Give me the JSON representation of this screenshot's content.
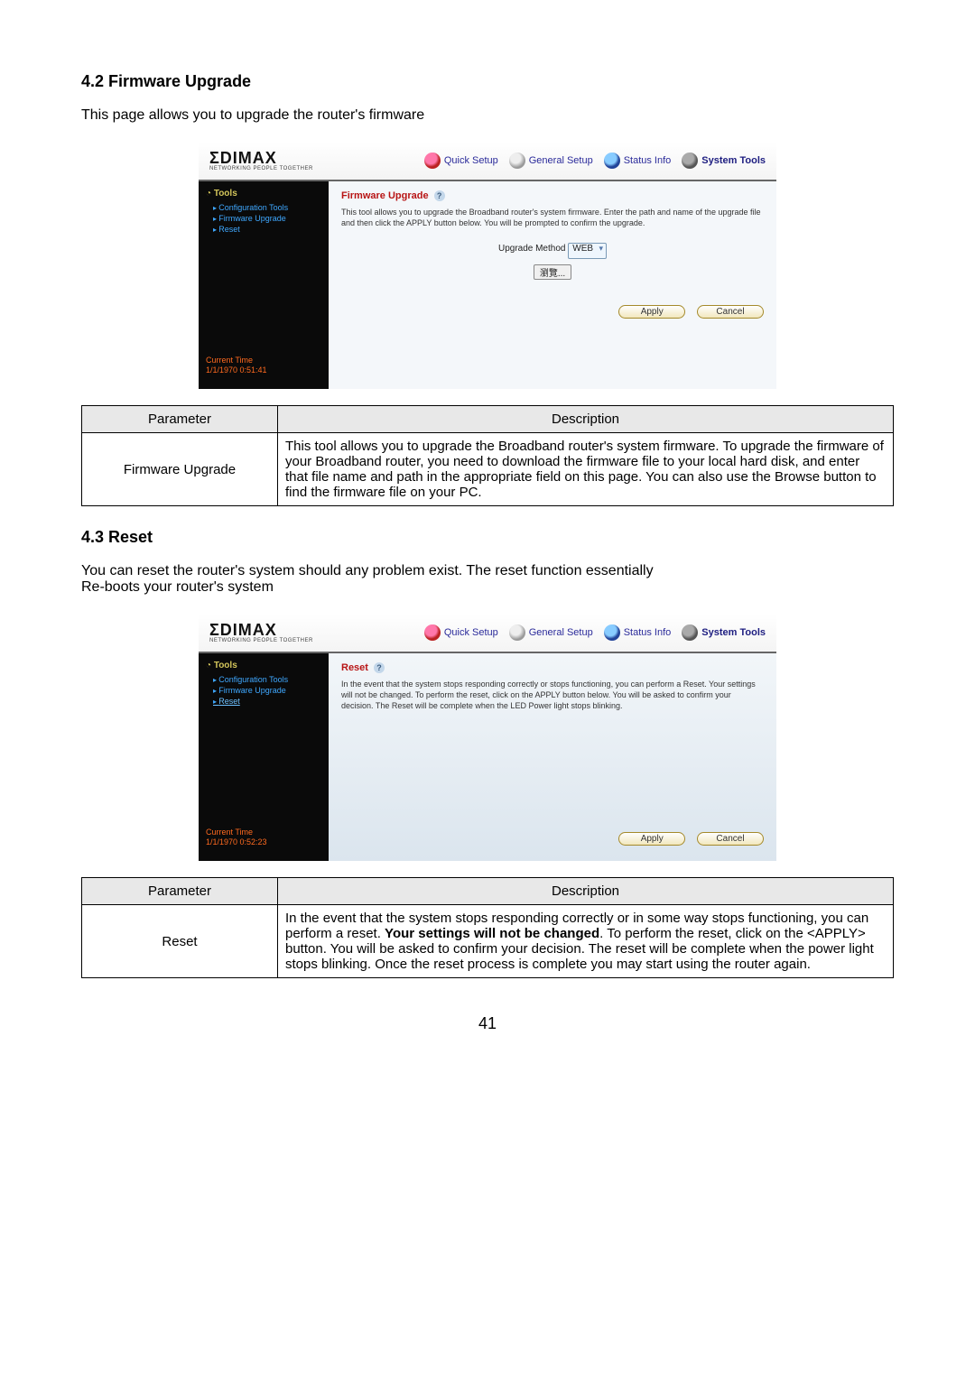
{
  "page_number": "41",
  "section_42": {
    "heading": "4.2 Firmware Upgrade",
    "intro": "This page allows you to upgrade the router's firmware"
  },
  "section_43": {
    "heading": "4.3 Reset",
    "intro_line1": "You can reset the router's system should any problem exist. The reset function essentially",
    "intro_line2": "Re-boots your router's system"
  },
  "table_headers": {
    "parameter": "Parameter",
    "description": "Description"
  },
  "table_firmware": {
    "param": "Firmware Upgrade",
    "desc": "This tool allows you to upgrade the Broadband router's system firmware. To upgrade the firmware of your Broadband router, you need to download the firmware file to your local hard disk, and enter that file name and path in the appropriate field on this page. You can also use the Browse button to find the firmware file on your PC."
  },
  "table_reset": {
    "param": "Reset",
    "desc_pre": "In the event that the system stops responding correctly or in some way stops functioning, you can perform a reset. ",
    "desc_bold": "Your settings will not be changed",
    "desc_post": ". To perform the reset, click on the <APPLY> button. You will be asked to confirm your decision. The reset will be complete when the power light stops blinking. Once the reset process is complete you may start using the router again."
  },
  "router_common": {
    "brand_main": "ΣDIMAX",
    "brand_sub": "NETWORKING PEOPLE TOGETHER",
    "nav": [
      "Quick Setup",
      "General Setup",
      "Status Info",
      "System Tools"
    ],
    "side_cat": "Tools",
    "side_links": [
      "Configuration Tools",
      "Firmware Upgrade",
      "Reset"
    ],
    "current_time_label": "Current Time",
    "apply": "Apply",
    "cancel": "Cancel"
  },
  "shot_firmware": {
    "title": "Firmware Upgrade",
    "desc": "This tool allows you to upgrade the Broadband router's system firmware. Enter the path and name of the upgrade file and then click the APPLY button below. You will be prompted to confirm the upgrade.",
    "method_label": "Upgrade Method",
    "method_value": "WEB",
    "browse_btn": "瀏覽...",
    "time": "1/1/1970 0:51:41"
  },
  "shot_reset": {
    "title": "Reset",
    "desc": "In the event that the system stops responding correctly or stops functioning, you can perform a Reset. Your settings will not be changed. To perform the reset, click on the APPLY button below. You will be asked to confirm your decision. The Reset will be complete when the LED Power light stops blinking.",
    "time": "1/1/1970 0:52:23"
  }
}
